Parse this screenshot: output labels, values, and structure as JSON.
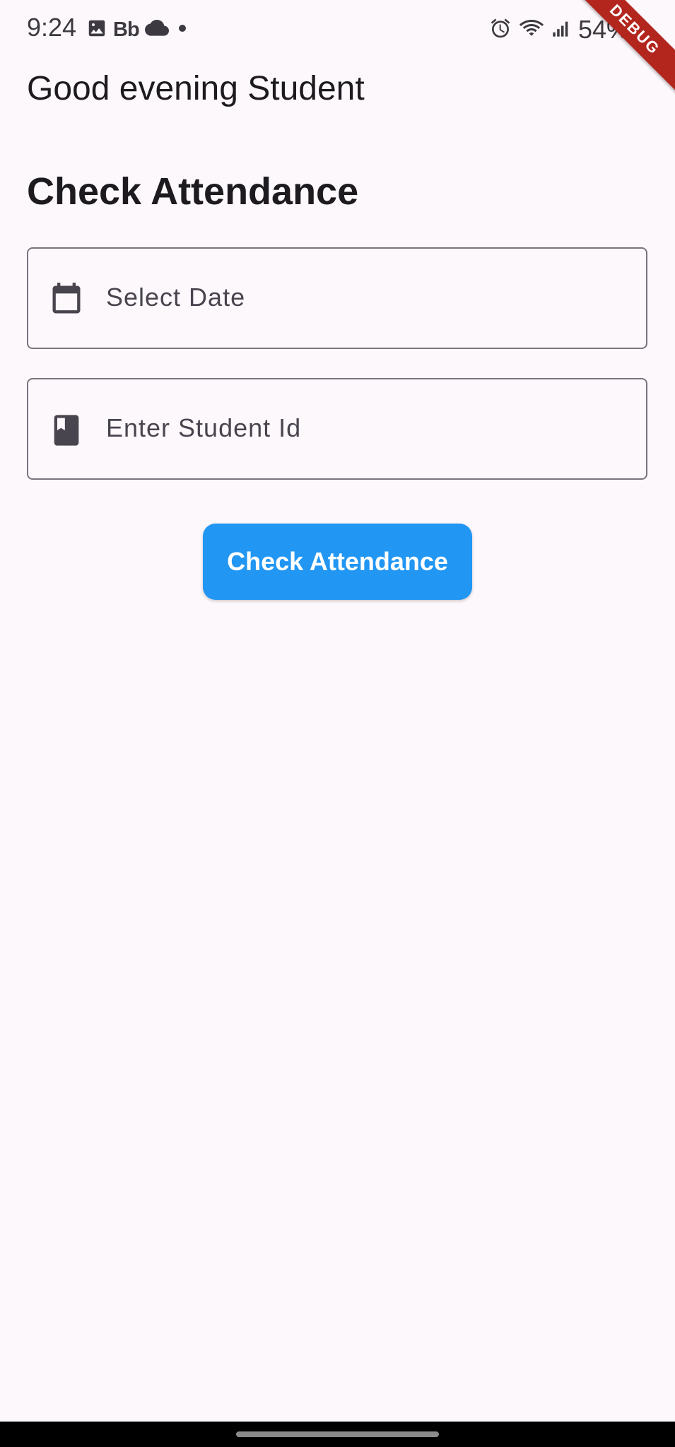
{
  "status_bar": {
    "time": "9:24",
    "bb_label": "Bb",
    "battery_text": "54%"
  },
  "debug_banner": {
    "label": "DEBUG"
  },
  "header": {
    "greeting": "Good evening Student",
    "section_title": "Check Attendance"
  },
  "form": {
    "date_field": {
      "placeholder": "Select Date",
      "icon": "calendar-icon"
    },
    "student_id_field": {
      "placeholder": "Enter Student Id",
      "icon": "book-icon"
    },
    "submit_label": "Check Attendance"
  },
  "colors": {
    "background": "#fdf8fc",
    "primary": "#2196f3",
    "debug_banner": "#b3261e",
    "outline": "#79747e"
  }
}
